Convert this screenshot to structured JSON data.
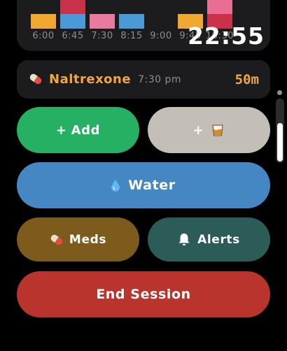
{
  "timeline": {
    "ticks": [
      "6:00",
      "6:45",
      "7:30",
      "8:15",
      "9:00",
      "9:45",
      "10:30"
    ],
    "colors": {
      "amber": "#f0a830",
      "blue": "#4a9ad8",
      "pink": "#e87aa0",
      "red": "#c93248",
      "pink_light": "#e86f93"
    }
  },
  "clock": "22:55",
  "medication": {
    "icon": "pill-icon",
    "name": "Naltrexone",
    "time": "7:30 pm",
    "remaining": "50m"
  },
  "buttons": {
    "add": {
      "plus": "+",
      "label": "Add"
    },
    "drink": {
      "plus": "+",
      "icon": "whisky-glass-icon"
    },
    "water": {
      "icon": "water-drop-icon",
      "label": "Water"
    },
    "meds": {
      "icon": "pill-icon",
      "label": "Meds"
    },
    "alerts": {
      "icon": "bell-icon",
      "label": "Alerts"
    },
    "end": {
      "label": "End Session"
    }
  },
  "colors": {
    "add": "#26b064",
    "drink": "#c4bfb6",
    "water": "#4587c2",
    "meds": "#7d5b1d",
    "alerts": "#2b5c57",
    "end": "#b8342c",
    "accent": "#f3a73b"
  }
}
